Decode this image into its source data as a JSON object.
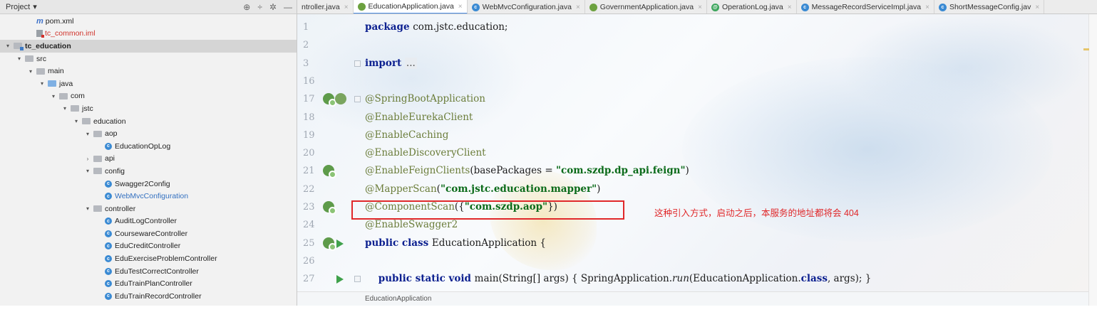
{
  "project_panel": {
    "title": "Project",
    "title_arrow": "▾",
    "tools": {
      "target": "⊕",
      "collapse": "÷",
      "gear": "✲",
      "hide": "—"
    },
    "tree": [
      {
        "label": "pom.xml",
        "icon": "maven",
        "level": 2,
        "arrow": "none"
      },
      {
        "label": "tc_common.iml",
        "icon": "iml-file",
        "level": 2,
        "arrow": "none",
        "style": "red"
      },
      {
        "label": "tc_education",
        "icon": "module-folder",
        "level": 0,
        "arrow": "▾",
        "style": "bold",
        "selected": true
      },
      {
        "label": "src",
        "icon": "folder",
        "level": 1,
        "arrow": "▾"
      },
      {
        "label": "main",
        "icon": "folder",
        "level": 2,
        "arrow": "▾"
      },
      {
        "label": "java",
        "icon": "source-folder",
        "level": 3,
        "arrow": "▾"
      },
      {
        "label": "com",
        "icon": "package",
        "level": 4,
        "arrow": "▾"
      },
      {
        "label": "jstc",
        "icon": "package",
        "level": 5,
        "arrow": "▾"
      },
      {
        "label": "education",
        "icon": "package",
        "level": 6,
        "arrow": "▾"
      },
      {
        "label": "aop",
        "icon": "package",
        "level": 7,
        "arrow": "▾"
      },
      {
        "label": "EducationOpLog",
        "icon": "class",
        "level": 8,
        "arrow": "none"
      },
      {
        "label": "api",
        "icon": "package",
        "level": 7,
        "arrow": "›"
      },
      {
        "label": "config",
        "icon": "package",
        "level": 7,
        "arrow": "▾"
      },
      {
        "label": "Swagger2Config",
        "icon": "class",
        "level": 8,
        "arrow": "none"
      },
      {
        "label": "WebMvcConfiguration",
        "icon": "class",
        "level": 8,
        "arrow": "none",
        "style": "blue"
      },
      {
        "label": "controller",
        "icon": "package",
        "level": 7,
        "arrow": "▾"
      },
      {
        "label": "AuditLogController",
        "icon": "class",
        "level": 8,
        "arrow": "none"
      },
      {
        "label": "CoursewareController",
        "icon": "class",
        "level": 8,
        "arrow": "none"
      },
      {
        "label": "EduCreditController",
        "icon": "class",
        "level": 8,
        "arrow": "none"
      },
      {
        "label": "EduExerciseProblemController",
        "icon": "class",
        "level": 8,
        "arrow": "none"
      },
      {
        "label": "EduTestCorrectController",
        "icon": "class",
        "level": 8,
        "arrow": "none"
      },
      {
        "label": "EduTrainPlanController",
        "icon": "class",
        "level": 8,
        "arrow": "none"
      },
      {
        "label": "EduTrainRecordController",
        "icon": "class",
        "level": 8,
        "arrow": "none"
      }
    ]
  },
  "tabs": [
    {
      "label": "ntroller.java",
      "icon": "none",
      "active": false
    },
    {
      "label": "EducationApplication.java",
      "icon": "spring-boot",
      "active": true
    },
    {
      "label": "WebMvcConfiguration.java",
      "icon": "class",
      "active": false
    },
    {
      "label": "GovernmentApplication.java",
      "icon": "spring-boot",
      "active": false
    },
    {
      "label": "OperationLog.java",
      "icon": "annotation",
      "active": false
    },
    {
      "label": "MessageRecordServiceImpl.java",
      "icon": "class",
      "active": false
    },
    {
      "label": "ShortMessageConfig.jav",
      "icon": "class",
      "active": false
    }
  ],
  "class_icon_letter": "c",
  "annotation_icon_letter": "@",
  "tab_close_glyph": "×",
  "gutter": [
    {
      "num": "1",
      "marks": []
    },
    {
      "num": "2",
      "marks": []
    },
    {
      "num": "3",
      "marks": [
        "fold"
      ]
    },
    {
      "num": "16",
      "marks": []
    },
    {
      "num": "17",
      "marks": [
        "bean",
        "bean2",
        "fold"
      ]
    },
    {
      "num": "18",
      "marks": []
    },
    {
      "num": "19",
      "marks": []
    },
    {
      "num": "20",
      "marks": []
    },
    {
      "num": "21",
      "marks": [
        "bean"
      ]
    },
    {
      "num": "22",
      "marks": []
    },
    {
      "num": "23",
      "marks": [
        "bean"
      ]
    },
    {
      "num": "24",
      "marks": []
    },
    {
      "num": "25",
      "marks": [
        "bean",
        "run"
      ]
    },
    {
      "num": "26",
      "marks": []
    },
    {
      "num": "27",
      "marks": [
        "run",
        "fold"
      ]
    }
  ],
  "code": [
    [
      {
        "t": "package ",
        "c": "kw"
      },
      {
        "t": "com.jstc.education;",
        "c": ""
      }
    ],
    [],
    [
      {
        "t": "import ",
        "c": "kw"
      },
      {
        "t": "...",
        "c": "fold-text"
      }
    ],
    [],
    [
      {
        "t": "@SpringBootApplication",
        "c": "ann"
      }
    ],
    [
      {
        "t": "@EnableEurekaClient",
        "c": "ann"
      }
    ],
    [
      {
        "t": "@EnableCaching",
        "c": "ann"
      }
    ],
    [
      {
        "t": "@EnableDiscoveryClient",
        "c": "ann"
      }
    ],
    [
      {
        "t": "@EnableFeignClients",
        "c": "ann"
      },
      {
        "t": "(basePackages = ",
        "c": ""
      },
      {
        "t": "\"com.szdp.dp_api.feign\"",
        "c": "str"
      },
      {
        "t": ")",
        "c": ""
      }
    ],
    [
      {
        "t": "@MapperScan",
        "c": "ann"
      },
      {
        "t": "(",
        "c": ""
      },
      {
        "t": "\"com.jstc.education.mapper\"",
        "c": "str"
      },
      {
        "t": ")",
        "c": ""
      }
    ],
    [
      {
        "t": "@ComponentScan",
        "c": "ann"
      },
      {
        "t": "({",
        "c": ""
      },
      {
        "t": "\"com.szdp.aop\"",
        "c": "str"
      },
      {
        "t": "})",
        "c": ""
      }
    ],
    [
      {
        "t": "@EnableSwagger2",
        "c": "ann"
      }
    ],
    [
      {
        "t": "public class ",
        "c": "kw"
      },
      {
        "t": "EducationApplication {",
        "c": ""
      }
    ],
    [],
    [
      {
        "t": "    public static void ",
        "c": "kw"
      },
      {
        "t": "main(String[] args) { SpringApplication.",
        "c": ""
      },
      {
        "t": "run",
        "c": "mth"
      },
      {
        "t": "(EducationApplication.",
        "c": ""
      },
      {
        "t": "class",
        "c": "kw"
      },
      {
        "t": ", args); }",
        "c": ""
      }
    ]
  ],
  "annotation_text": "这种引入方式，启动之后，本服务的地址都将会 404",
  "breadcrumb": "EducationApplication"
}
